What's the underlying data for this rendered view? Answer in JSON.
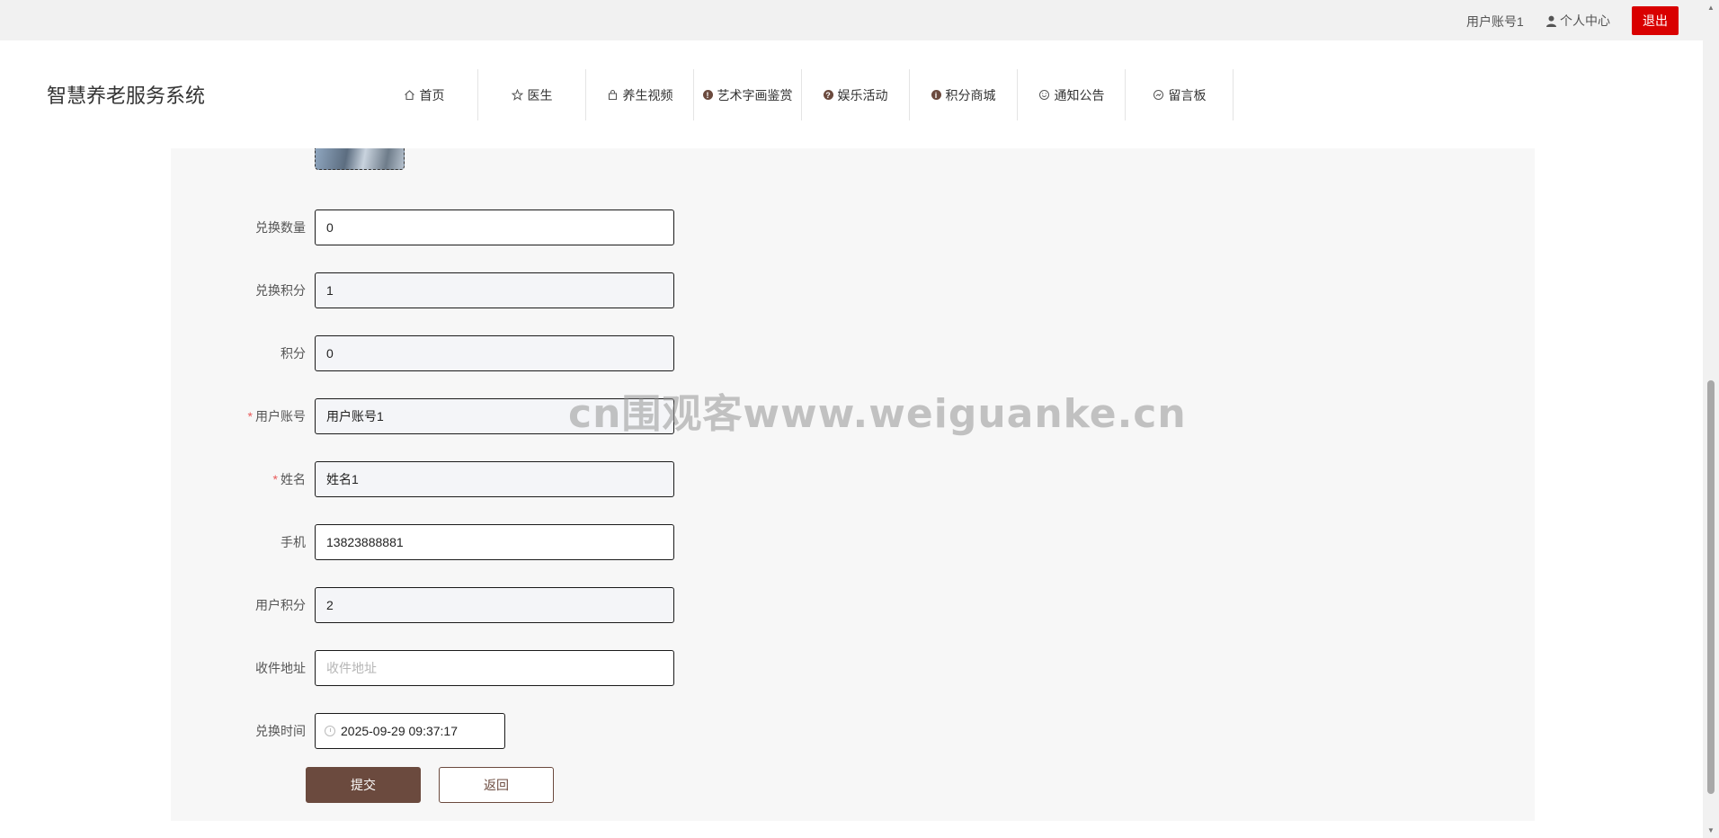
{
  "topbar": {
    "user_name": "用户账号1",
    "profile_label": "个人中心",
    "logout_label": "退出"
  },
  "header": {
    "title": "智慧养老服务系统"
  },
  "nav": [
    {
      "label": "首页",
      "icon": "home-icon"
    },
    {
      "label": "医生",
      "icon": "star-icon"
    },
    {
      "label": "养生视频",
      "icon": "bag-icon"
    },
    {
      "label": "艺术字画鉴赏",
      "icon": "info-dot-icon"
    },
    {
      "label": "娱乐活动",
      "icon": "question-dot-icon"
    },
    {
      "label": "积分商城",
      "icon": "info-dot-icon"
    },
    {
      "label": "通知公告",
      "icon": "smile-icon"
    },
    {
      "label": "留言板",
      "icon": "comment-icon"
    }
  ],
  "form": {
    "exchange_qty": {
      "label": "兑换数量",
      "value": "0"
    },
    "exchange_points": {
      "label": "兑换积分",
      "value": "1"
    },
    "points": {
      "label": "积分",
      "value": "0"
    },
    "account": {
      "label": "用户账号",
      "value": "用户账号1",
      "required": "*"
    },
    "name": {
      "label": "姓名",
      "value": "姓名1",
      "required": "*"
    },
    "phone": {
      "label": "手机",
      "value": "13823888881"
    },
    "user_points": {
      "label": "用户积分",
      "value": "2"
    },
    "address": {
      "label": "收件地址",
      "value": "",
      "placeholder": "收件地址"
    },
    "exchange_time": {
      "label": "兑换时间",
      "value": "2025-09-29 09:37:17"
    }
  },
  "buttons": {
    "submit": "提交",
    "back": "返回"
  },
  "watermark": "cn围观客www.weiguanke.cn"
}
